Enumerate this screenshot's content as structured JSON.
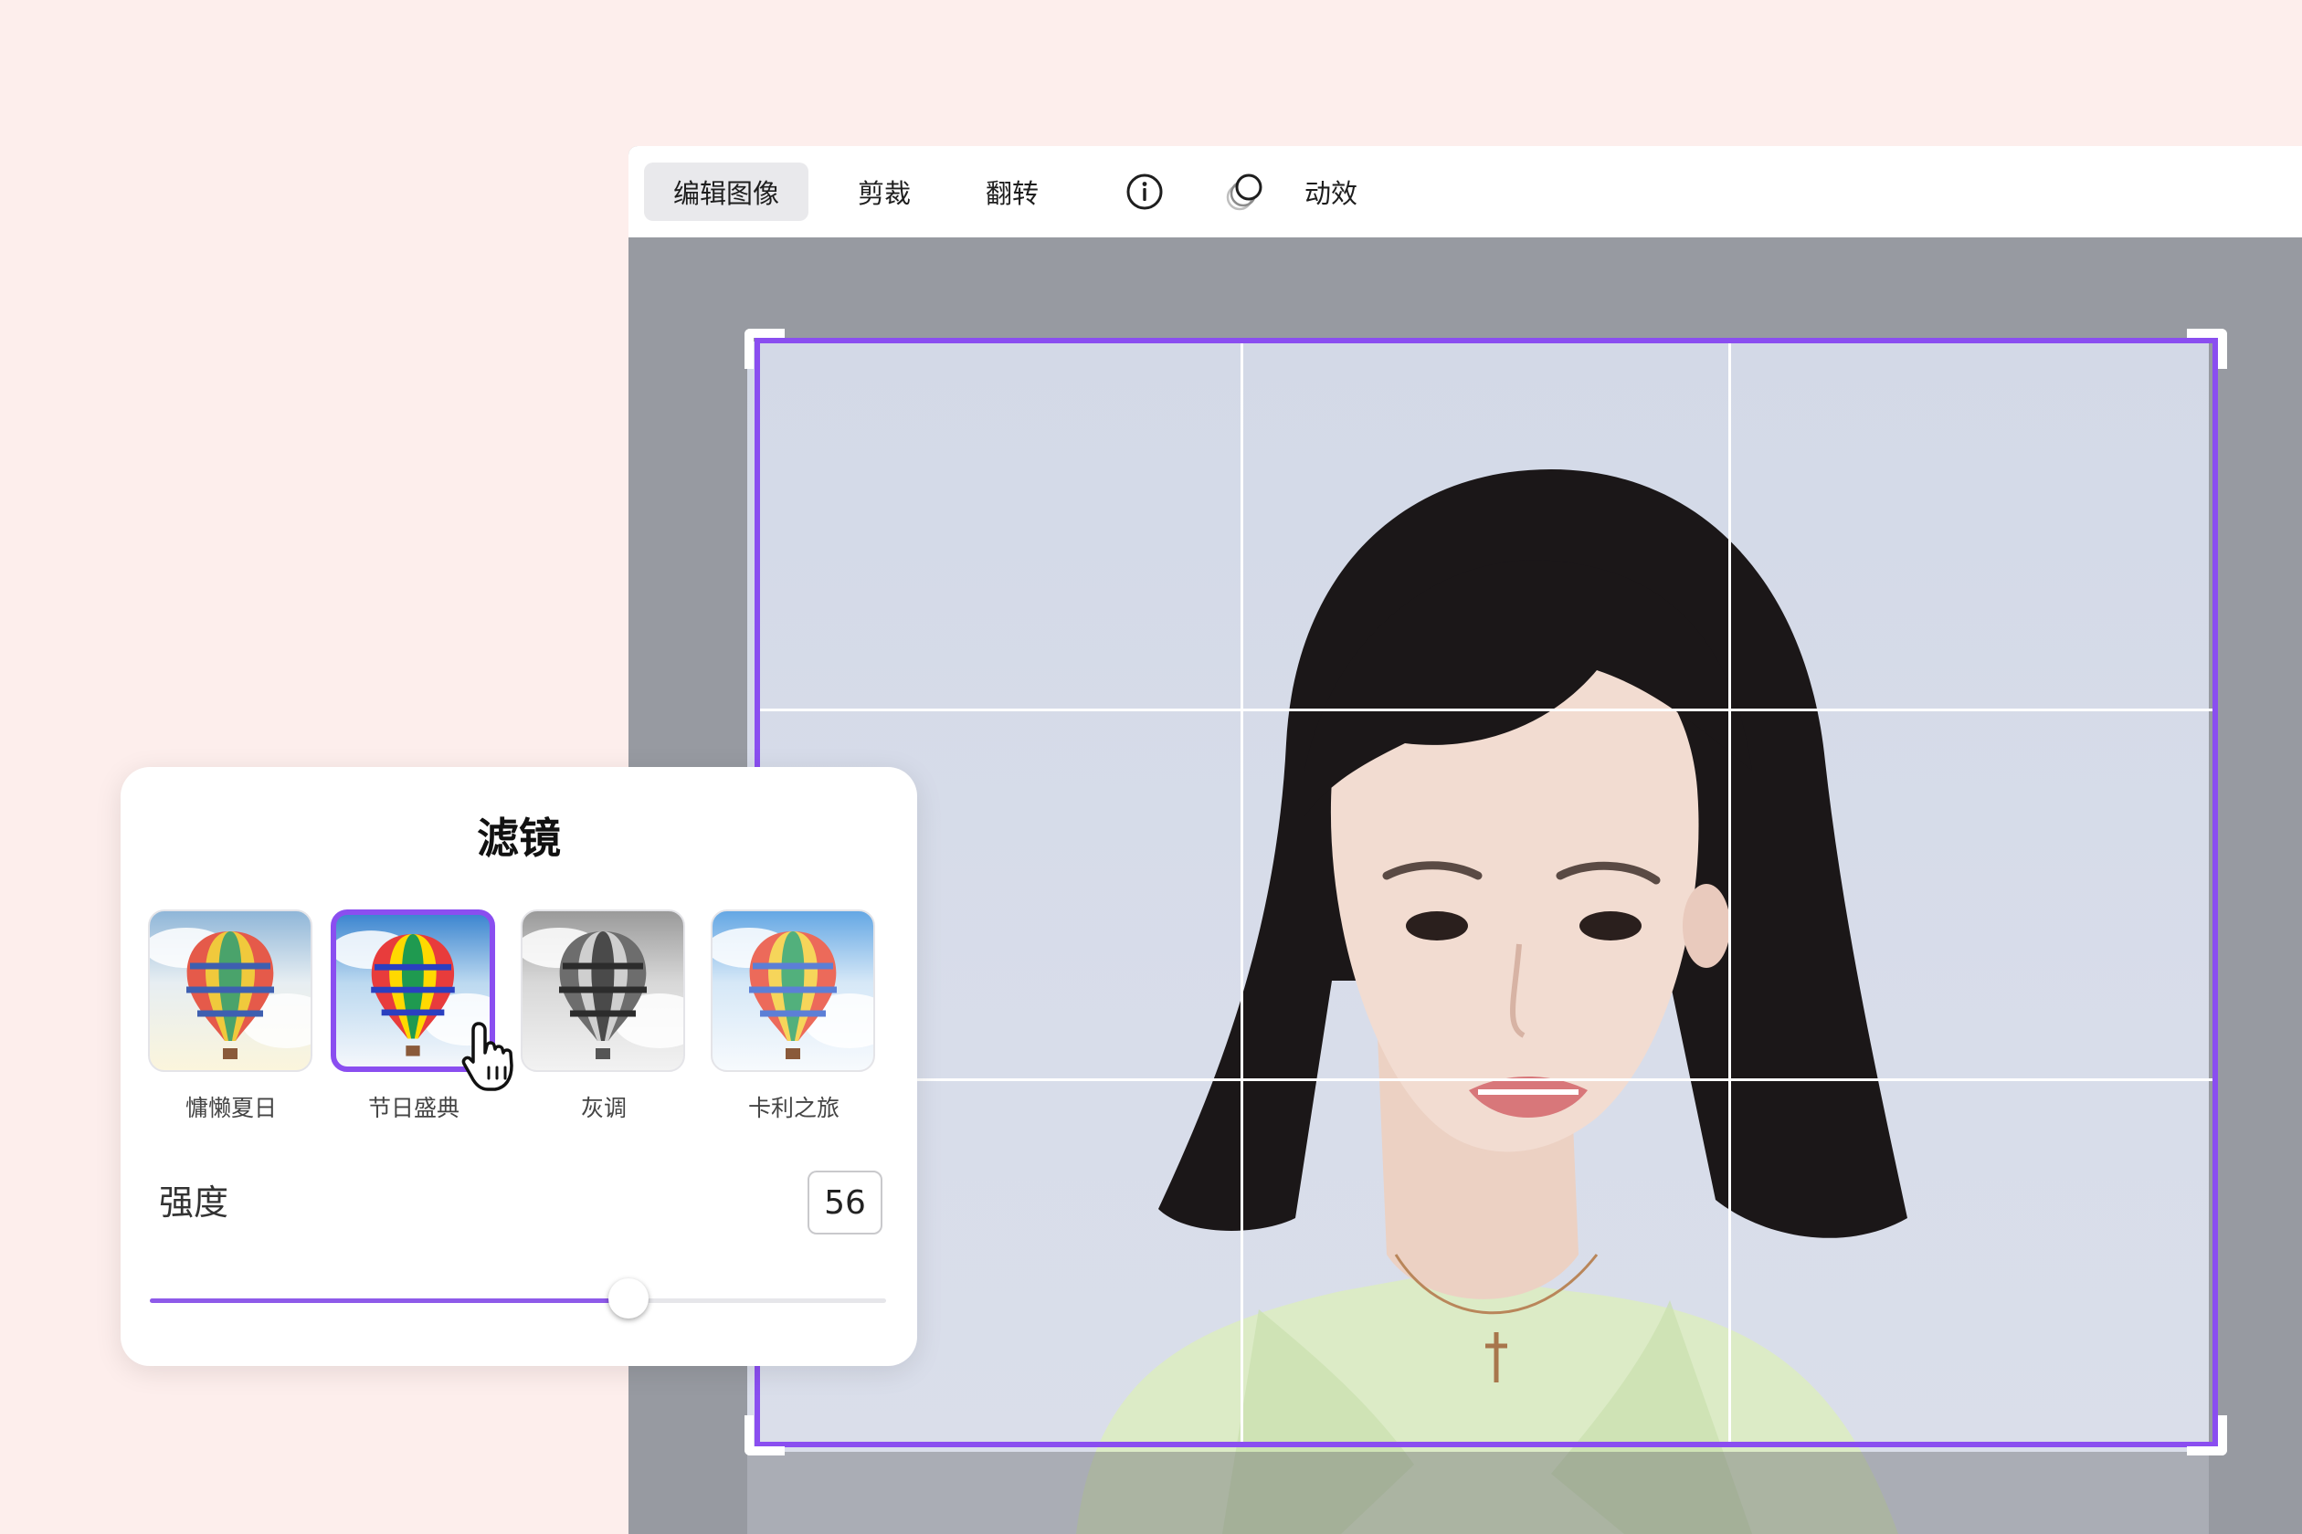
{
  "toolbar": {
    "edit_image_label": "编辑图像",
    "crop_label": "剪裁",
    "flip_label": "翻转",
    "animation_label": "动效"
  },
  "filter_panel": {
    "title": "滤镜",
    "filters": [
      {
        "label": "慵懒夏日",
        "style": "warm",
        "selected": false
      },
      {
        "label": "节日盛典",
        "style": "vivid",
        "selected": true
      },
      {
        "label": "灰调",
        "style": "gray",
        "selected": false
      },
      {
        "label": "卡利之旅",
        "style": "cool",
        "selected": false
      }
    ],
    "strength_label": "强度",
    "strength_value": "56",
    "strength_fraction": 0.65
  },
  "colors": {
    "accent": "#8a4ef0",
    "page_background": "#fdeeec",
    "canvas_background": "#979aa1"
  },
  "icons": {
    "info": "info-circle-icon",
    "animation": "overlapping-circles-icon",
    "cursor": "hand-pointer-icon",
    "balloon": "hot-air-balloon"
  }
}
